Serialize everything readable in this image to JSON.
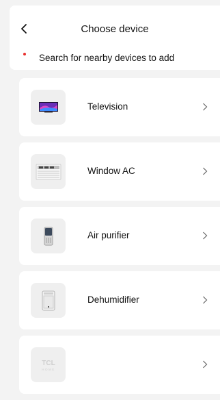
{
  "header": {
    "title": "Choose device",
    "search_label": "Search for nearby devices to add"
  },
  "devices": [
    {
      "label": "Television",
      "icon": "television-icon"
    },
    {
      "label": "Window AC",
      "icon": "window-ac-icon"
    },
    {
      "label": "Air purifier",
      "icon": "air-purifier-icon"
    },
    {
      "label": "Dehumidifier",
      "icon": "dehumidifier-icon"
    },
    {
      "label": "",
      "icon": "tcl-home-logo-icon",
      "logo_text": "TCL",
      "logo_sub": "HOME"
    }
  ],
  "colors": {
    "background": "#f3f3f3",
    "card": "#ffffff",
    "thumb_bg": "#efefef",
    "dot": "#e8302e"
  }
}
